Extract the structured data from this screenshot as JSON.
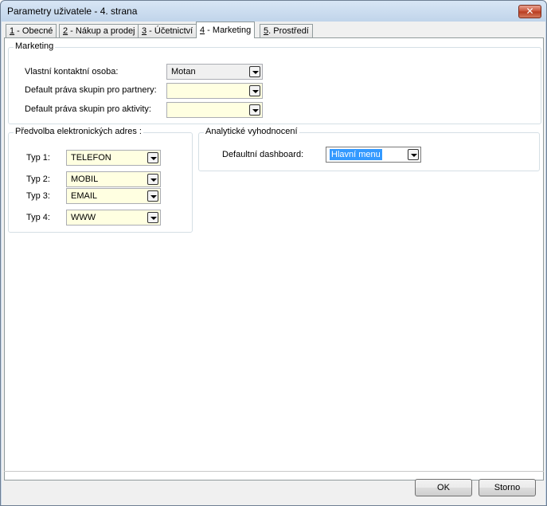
{
  "window": {
    "title": "Parametry uživatele - 4. strana",
    "close_label": "✕"
  },
  "tabs": [
    {
      "key": "1",
      "rest": " - Obecné"
    },
    {
      "key": "2",
      "rest": " - Nákup a prodej"
    },
    {
      "key": "3",
      "rest": " - Účetnictví"
    },
    {
      "key": "4",
      "rest": " - Marketing"
    },
    {
      "key": "5",
      "rest": ". Prostředí"
    }
  ],
  "active_tab": "4 - Marketing",
  "marketing": {
    "legend": "Marketing",
    "contact_label": "Vlastní kontaktní osoba:",
    "contact_value": "Motan",
    "partners_label": "Default práva skupin pro partnery:",
    "partners_value": "",
    "activities_label": "Default práva skupin pro aktivity:",
    "activities_value": ""
  },
  "addresses": {
    "legend": "Předvolba elektronických adres :",
    "rows": [
      {
        "label": "Typ 1:",
        "value": "TELEFON"
      },
      {
        "label": "Typ 2:",
        "value": "MOBIL"
      },
      {
        "label": "Typ 3:",
        "value": "EMAIL"
      },
      {
        "label": "Typ 4:",
        "value": "WWW"
      }
    ]
  },
  "analytics": {
    "legend": "Analytické vyhodnocení",
    "dashboard_label": "Defaultní dashboard:",
    "dashboard_value": "Hlavní menu"
  },
  "buttons": {
    "ok": "OK",
    "cancel": "Storno"
  }
}
